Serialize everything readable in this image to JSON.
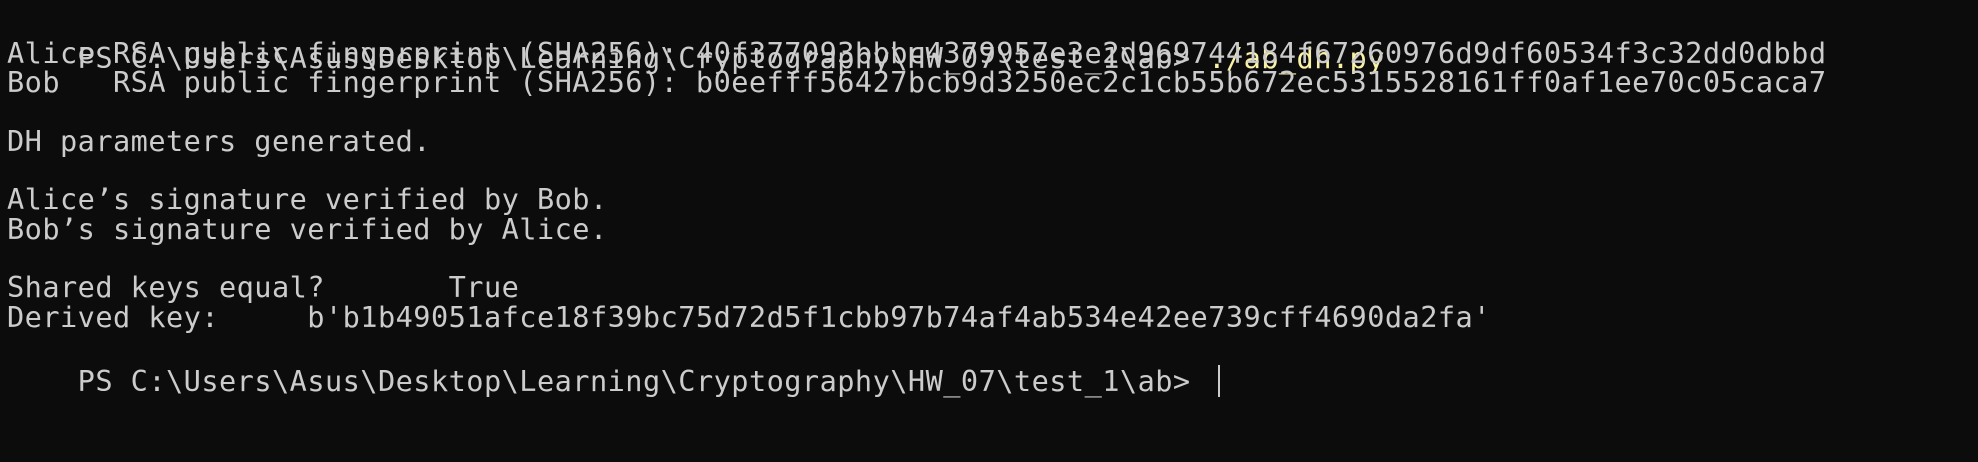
{
  "terminal": {
    "prompt": "PS C:\\Users\\Asus\\Desktop\\Learning\\Cryptography\\HW_07\\test_1\\ab> ",
    "command": "./ab_dh.py",
    "lines": {
      "alice_fingerprint": "Alice RSA public fingerprint (SHA256): 40f377093bbbc4379957e3e2d969744184f67260976d9df60534f3c32dd0dbbd",
      "bob_fingerprint": "Bob   RSA public fingerprint (SHA256): b0eefff56427bcb9d3250ec2c1cb55b672ec5315528161ff0af1ee70c05caca7",
      "dh_params": "DH parameters generated.",
      "alice_verified": "Alice’s signature verified by Bob.",
      "bob_verified": "Bob’s signature verified by Alice.",
      "shared_keys": "Shared keys equal?       True",
      "derived_key": "Derived key:     b'b1b49051afce18f39bc75d72d5f1cbb97b74af4ab534e42ee739cff4690da2fa'"
    },
    "final_prompt": "PS C:\\Users\\Asus\\Desktop\\Learning\\Cryptography\\HW_07\\test_1\\ab> ",
    "colors": {
      "background": "#0c0c0c",
      "text": "#cccccc",
      "command": "#f9f1a5"
    }
  }
}
